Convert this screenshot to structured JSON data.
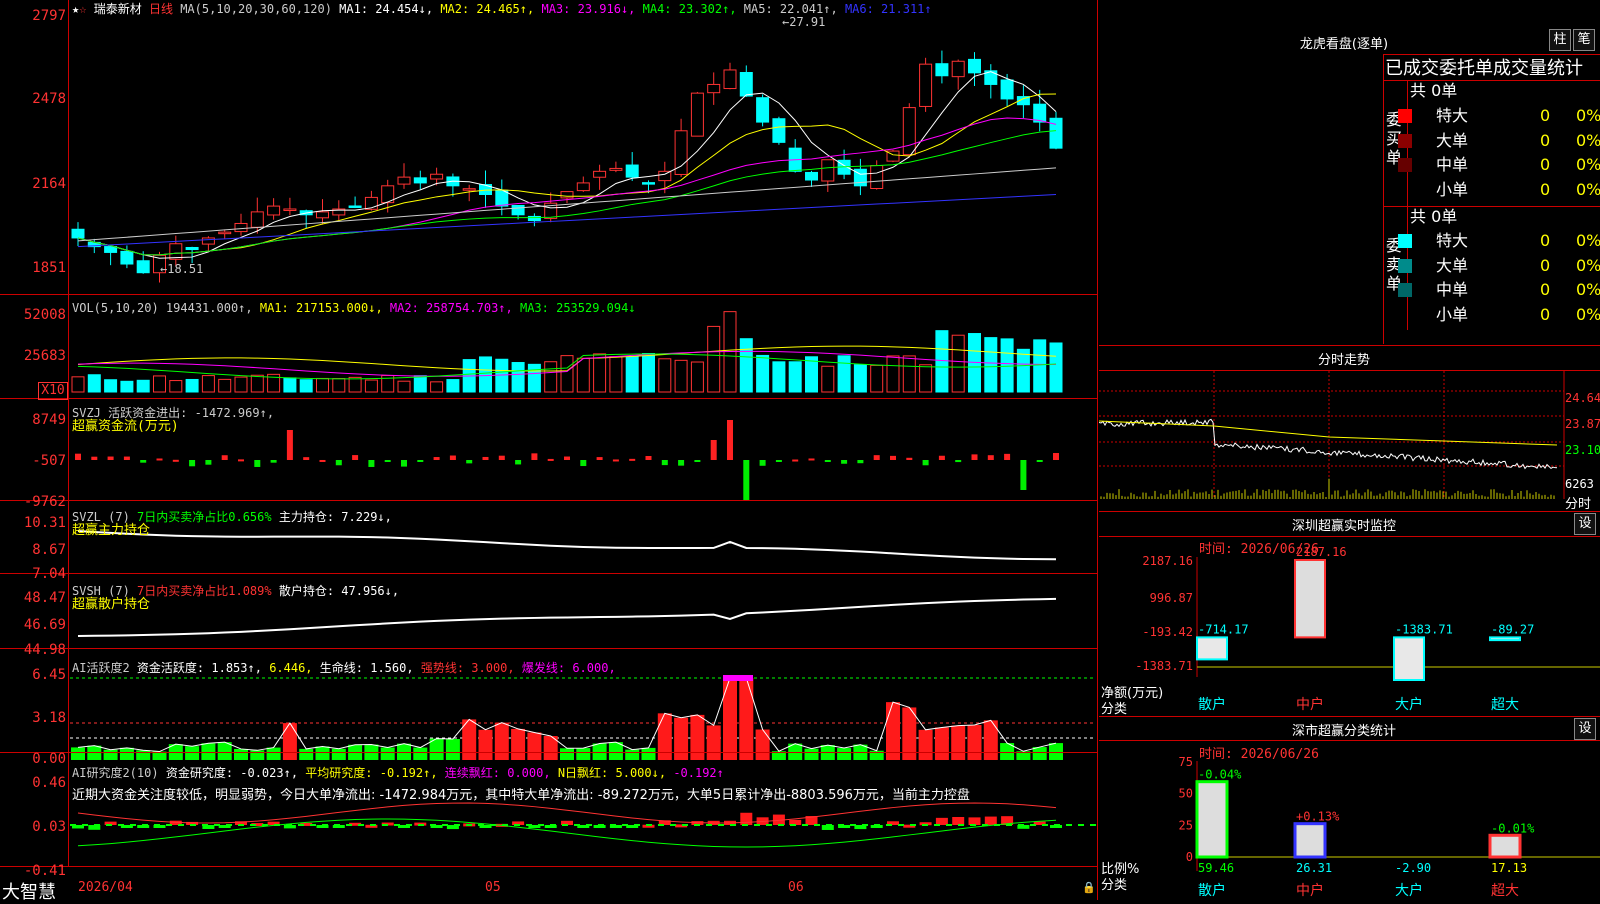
{
  "main": {
    "price_header": {
      "stock": "瑞泰新材",
      "period": "日线",
      "ma_label": "MA(5,10,20,30,60,120)",
      "ma1": "MA1: 24.454↓,",
      "ma2": "MA2: 24.465↑,",
      "ma3": "MA3: 23.916↓,",
      "ma4": "MA4: 23.302↑,",
      "ma5": "MA5: 22.041↑,",
      "ma6": "MA6: 21.311↑"
    },
    "price_axis": [
      "2797",
      "2478",
      "2164",
      "1851"
    ],
    "high_label": "27.91",
    "low_label": "18.51",
    "vol_header": {
      "label": "VOL(5,10,20) 194431.000↑,",
      "ma1": "MA1: 217153.000↓,",
      "ma2": "MA2: 258754.703↑,",
      "ma3": "MA3: 253529.094↓"
    },
    "vol_axis": [
      "52008",
      "25683",
      "X10"
    ],
    "svzj_header": {
      "label": "SVZJ  活跃资金进出: -1472.969↑,",
      "sub": "超赢资金流(万元)"
    },
    "svzj_axis": [
      "8749",
      "-507",
      "-9762"
    ],
    "svzl_header": {
      "label": "SVZL (7)",
      "pct": "7日内买卖净占比0.656%",
      "hold": "主力持仓: 7.229↓,",
      "sub": "超赢主力持仓"
    },
    "svzl_axis": [
      "10.31",
      "8.67",
      "7.04"
    ],
    "svsh_header": {
      "label": "SVSH (7)",
      "pct": "7日内买卖净占比1.089%",
      "hold": "散户持仓: 47.956↓,",
      "sub": "超赢散户持仓"
    },
    "svsh_axis": [
      "48.47",
      "46.69",
      "44.98"
    ],
    "ai1_header": {
      "label": "AI活跃度2",
      "a": "资金活跃度: 1.853↑,",
      "b": "6.446,",
      "c": "生命线: 1.560,",
      "d": "强势线: 3.000,",
      "e": "爆发线: 6.000,"
    },
    "ai1_axis": [
      "6.45",
      "3.18",
      "0.00"
    ],
    "ai2_header": {
      "label": "AI研究度2(10)",
      "a": "资金研究度: -0.023↑,",
      "b": "平均研究度: -0.192↑,",
      "c": "连续飘红: 0.000,",
      "d": "N日飘红: 5.000↓,",
      "e": "-0.192↑"
    },
    "ai2_text": "近期大资金关注度较低，明显弱势，今日大单净流出: -1472.984万元，其中特大单净流出: -89.272万元，大单5日累计净出-8803.596万元，当前主力控盘",
    "ai2_axis": [
      "0.46",
      "0.03",
      "-0.41"
    ],
    "date_axis": [
      "2026/04",
      "05",
      "06"
    ],
    "brand": "大智慧"
  },
  "dragon": {
    "title": "龙虎看盘(逐单)",
    "btn1": "柱",
    "btn2": "笔",
    "tabs": "已成交委托单成交量统计",
    "buy_total": "共 0单",
    "buy_label": "委买单",
    "sell_total": "共 0单",
    "sell_label": "委卖单",
    "rows": [
      {
        "name": "特大",
        "count": "0",
        "pct": "0%"
      },
      {
        "name": "大单",
        "count": "0",
        "pct": "0%"
      },
      {
        "name": "中单",
        "count": "0",
        "pct": "0%"
      },
      {
        "name": "小单",
        "count": "0",
        "pct": "0%"
      }
    ],
    "colors": {
      "buy_xl": "#ff0000",
      "buy_l": "#8b0000",
      "buy_m": "#660000",
      "sell_xl": "#00ffff",
      "sell_l": "#008b8b",
      "sell_m": "#006666"
    }
  },
  "intraday": {
    "title": "分时走势",
    "axis": [
      "24.64",
      "23.87",
      "23.10",
      "6263",
      "分时"
    ]
  },
  "monitor": {
    "title": "深圳超赢实时监控",
    "btn": "设",
    "time": "时间: 2026/06/26",
    "axis": [
      "2187.16",
      "996.87",
      "-193.42",
      "-1383.71"
    ],
    "unit": "净额(万元)",
    "cat_label": "分类",
    "bar_labels": [
      "-714.17",
      "2187.16",
      "-1383.71",
      "-89.27"
    ],
    "categories": [
      "散户",
      "中户",
      "大户",
      "超大"
    ],
    "values": [
      -714.17,
      2187.16,
      -1383.71,
      -89.27
    ]
  },
  "classify": {
    "title": "深市超赢分类统计",
    "btn": "设",
    "time": "时间: 2026/06/26",
    "axis": [
      "75",
      "50",
      "25",
      "0"
    ],
    "unit": "比例%",
    "cat_label": "分类",
    "top_labels": [
      "-0.04%",
      "+0.13%",
      "",
      "-0.01%"
    ],
    "bottom_labels": [
      "59.46",
      "26.31",
      "-2.90",
      "17.13"
    ],
    "categories": [
      "散户",
      "中户",
      "大户",
      "超大"
    ],
    "values": [
      59.46,
      26.31,
      -2.9,
      17.13
    ]
  }
}
